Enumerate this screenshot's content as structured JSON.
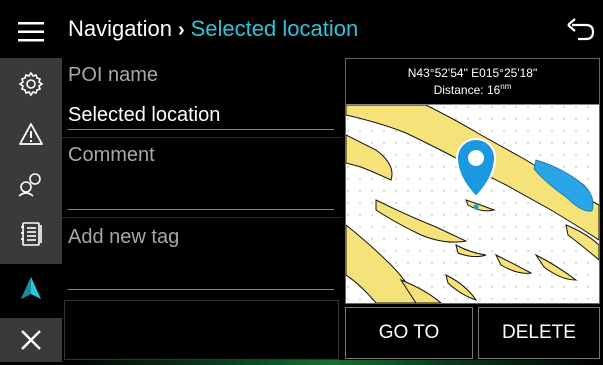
{
  "sidebar": {
    "icons": [
      "menu-icon",
      "gear-icon",
      "warning-icon",
      "group-icon",
      "book-icon",
      "navigation-arrow-icon",
      "close-icon"
    ],
    "nav_color": "#2ec4d8"
  },
  "header": {
    "breadcrumb": "Navigation",
    "separator": "›",
    "current": "Selected location",
    "back_icon": "back-arrow-icon"
  },
  "form": {
    "poi_label": "POI name",
    "poi_value": "Selected location",
    "comment_label": "Comment",
    "tag_label": "Add new tag"
  },
  "map": {
    "coordinates": "N43°52'54\" E015°25'18\"",
    "distance_label": "Distance: ",
    "distance_value": "16",
    "distance_unit": "nm",
    "land_color": "#f5e37a",
    "water_color": "#2aa6e8",
    "pin_color": "#1b98e0"
  },
  "buttons": {
    "goto": "GO TO",
    "delete": "DELETE"
  },
  "accent": "#2ec4d8"
}
